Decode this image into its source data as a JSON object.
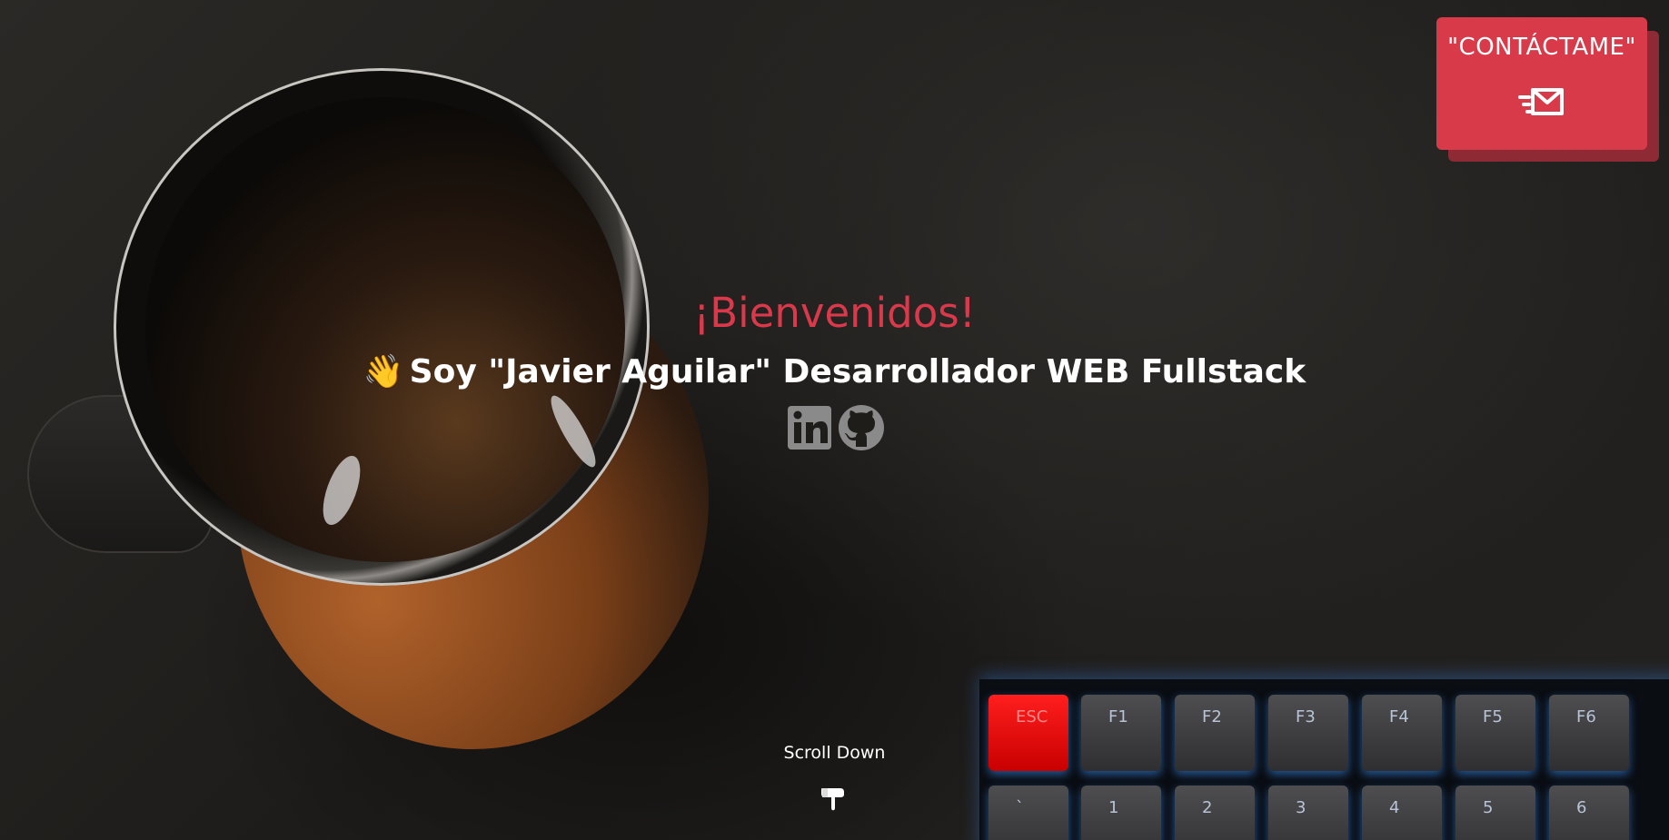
{
  "hero": {
    "title": "¡Bienvenidos!",
    "wave_emoji": "👋",
    "subtitle": "Soy \"Javier Aguilar\" Desarrollador WEB Fullstack",
    "scroll_text": "Scroll Down"
  },
  "contact": {
    "label": "\"CONTÁCTAME\""
  },
  "keyboard": {
    "row1": [
      "ESC",
      "F1",
      "F2",
      "F3",
      "F4",
      "F5",
      "F6"
    ],
    "row2": [
      "`",
      "1",
      "2",
      "3",
      "4",
      "5",
      "6"
    ]
  },
  "colors": {
    "accent": "#d9394b",
    "button_shadow": "#8d2a33",
    "text": "#ffffff",
    "icon_gray": "#8a8a8a"
  }
}
